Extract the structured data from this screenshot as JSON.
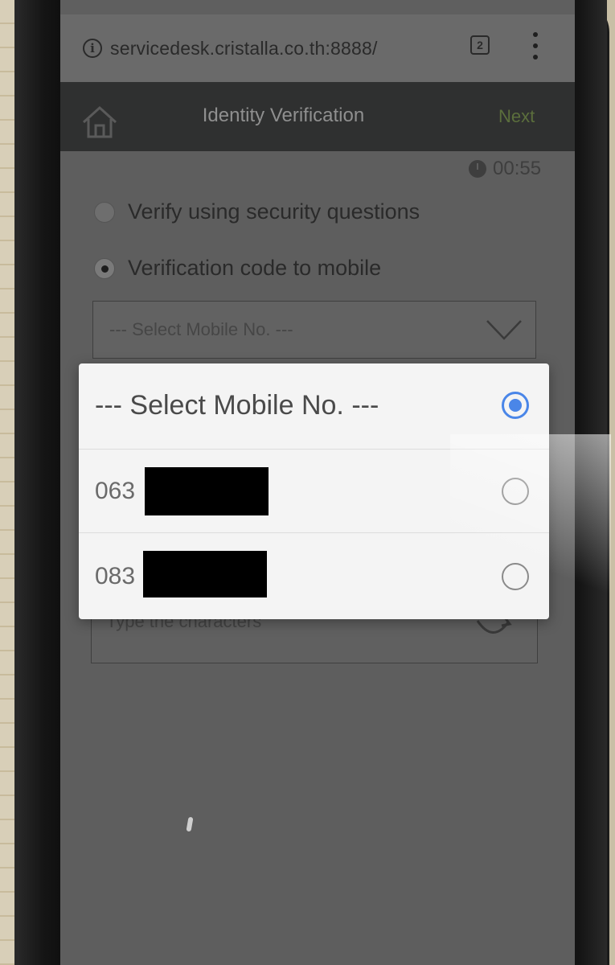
{
  "browser": {
    "url": "servicedesk.cristalla.co.th:8888/",
    "tab_count": "2"
  },
  "header": {
    "title": "Identity Verification",
    "next_label": "Next"
  },
  "timer": {
    "value": "00:55"
  },
  "options": {
    "security_questions_label": "Verify using security questions",
    "mobile_code_label": "Verification code to mobile"
  },
  "mobile_select": {
    "placeholder": "--- Select Mobile No. ---"
  },
  "captcha": {
    "placeholder": "Type the characters"
  },
  "popup": {
    "title": "--- Select Mobile No. ---",
    "items": [
      {
        "prefix": "063"
      },
      {
        "prefix": "083"
      }
    ],
    "selected_index": 0
  },
  "colors": {
    "accent": "#4a86e8",
    "appbar": "#2f3030"
  }
}
